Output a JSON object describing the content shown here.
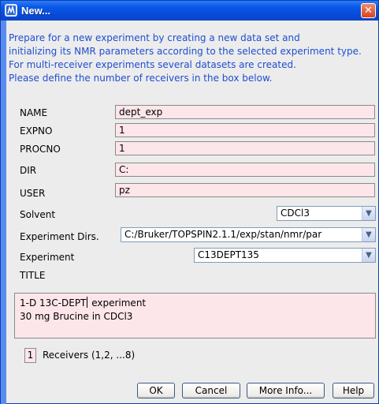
{
  "window": {
    "title": "New...",
    "close_glyph": "✕"
  },
  "intro": [
    "Prepare for a new experiment by creating a new data set and",
    "initializing its NMR parameters according to the selected experiment type.",
    "For multi-receiver experiments several datasets are created.",
    "Please define the number of receivers in the box below."
  ],
  "fields": {
    "name": {
      "label": "NAME",
      "value": "dept_exp"
    },
    "expno": {
      "label": "EXPNO",
      "value": "1"
    },
    "procno": {
      "label": "PROCNO",
      "value": "1"
    },
    "dir": {
      "label": "DIR",
      "value": "C:"
    },
    "user": {
      "label": "USER",
      "value": "pz"
    }
  },
  "solvent": {
    "label": "Solvent",
    "value": "CDCl3"
  },
  "experiment_dirs": {
    "label": "Experiment Dirs.",
    "value": "C:/Bruker/TOPSPIN2.1.1/exp/stan/nmr/par"
  },
  "experiment": {
    "label": "Experiment",
    "value": "C13DEPT135"
  },
  "title_field": {
    "label": "TITLE",
    "line1_before_caret": "1-D 13C-DEPT",
    "line1_after_caret": " experiment",
    "line2": "30 mg Brucine in CDCl3"
  },
  "receivers": {
    "value": "1",
    "label": "Receivers (1,2, ...8)"
  },
  "buttons": {
    "ok": "OK",
    "cancel": "Cancel",
    "more_info": "More Info...",
    "help": "Help"
  },
  "icons": {
    "app": "bruker-app-icon",
    "dropdown": "chevron-down-icon",
    "close": "close-icon"
  },
  "colors": {
    "titlebar": "#0a5ae8",
    "intro_text": "#1f4ed0",
    "field_bg": "#fce6ea",
    "dialog_bg": "#ececec"
  }
}
